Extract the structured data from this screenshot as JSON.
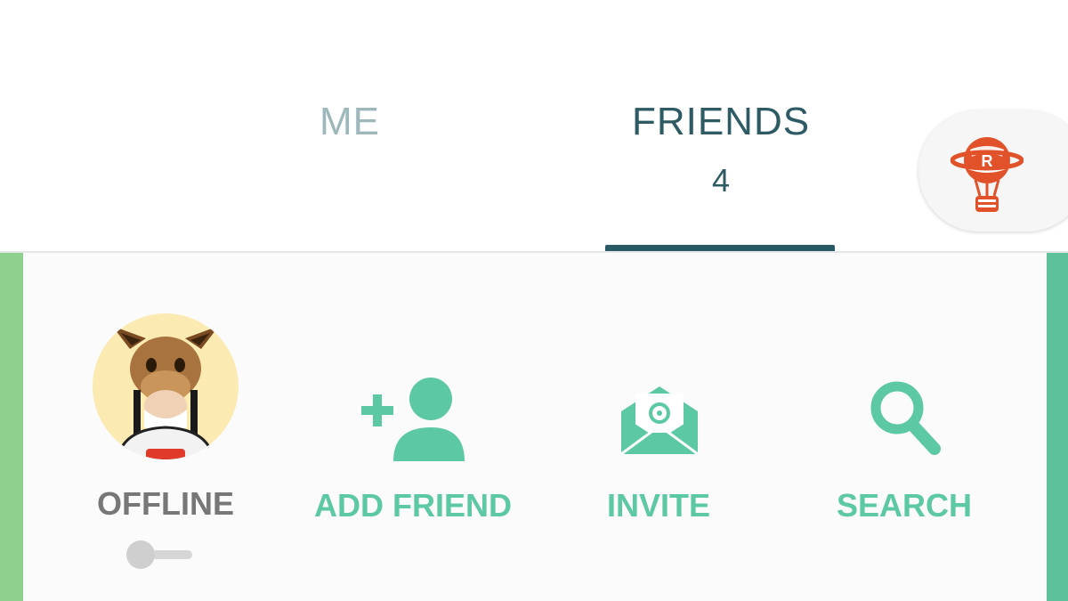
{
  "tabs": {
    "me": {
      "label": "ME"
    },
    "friends": {
      "label": "FRIENDS",
      "count": "4"
    }
  },
  "header_icons": {
    "balloon": "team-rocket-balloon-icon"
  },
  "actions": {
    "offline": {
      "label": "OFFLINE",
      "icon": "eevee-avatar"
    },
    "add_friend": {
      "label": "ADD FRIEND",
      "icon": "add-person-icon"
    },
    "invite": {
      "label": "INVITE",
      "icon": "envelope-icon"
    },
    "search": {
      "label": "SEARCH",
      "icon": "magnifier-icon"
    }
  },
  "online_toggle": {
    "state": "off"
  },
  "colors": {
    "accent": "#5cc8a4",
    "tab_active": "#2d5a63",
    "tab_inactive": "#9db7bb",
    "offline_text": "#777777",
    "balloon": "#e2522a",
    "panel_border_left": "#8ed08e",
    "panel_border_right": "#5dc19c"
  }
}
